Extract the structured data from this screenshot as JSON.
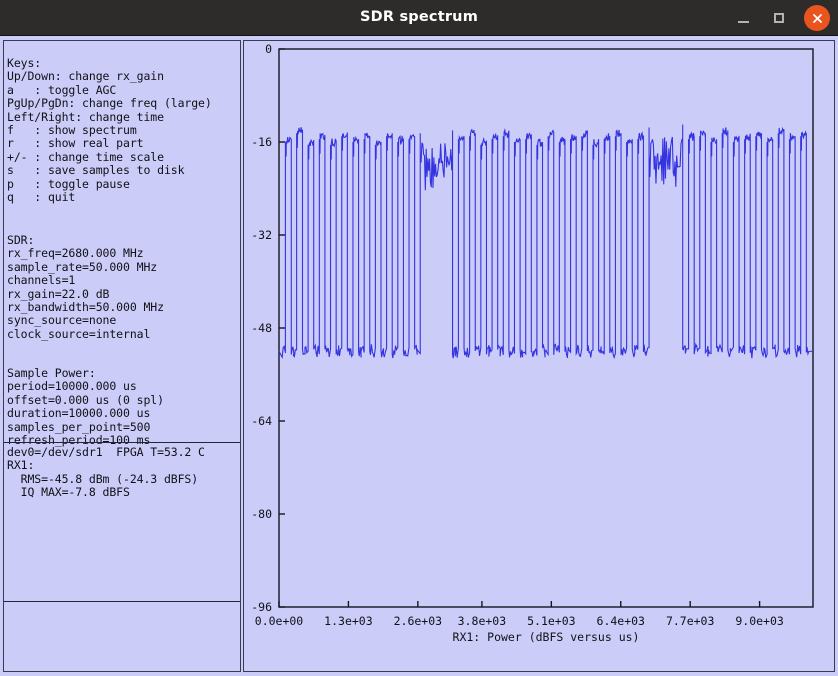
{
  "window": {
    "title": "SDR spectrum",
    "controls": {
      "minimize": "minimize-button",
      "maximize": "maximize-button",
      "close": "close-button"
    },
    "bg_color": "#ccccf8",
    "titlebar_color": "#2e2c2b",
    "close_color": "#e9541f"
  },
  "info_panel": {
    "keys_section": {
      "heading": "Keys:",
      "lines": [
        "Up/Down: change rx_gain",
        "a   : toggle AGC",
        "PgUp/PgDn: change freq (large)",
        "Left/Right: change time",
        "f   : show spectrum",
        "r   : show real part",
        "+/- : change time scale",
        "s   : save samples to disk",
        "p   : toggle pause",
        "q   : quit"
      ]
    },
    "sdr_section": {
      "heading": "SDR:",
      "lines": [
        "rx_freq=2680.000 MHz",
        "sample_rate=50.000 MHz",
        "channels=1",
        "rx_gain=22.0 dB",
        "rx_bandwidth=50.000 MHz",
        "sync_source=none",
        "clock_source=internal"
      ]
    },
    "sample_power_section": {
      "heading": "Sample Power:",
      "lines": [
        "period=10000.000 us",
        "offset=0.000 us (0 spl)",
        "duration=10000.000 us",
        "samples_per_point=500",
        "refresh_period=100 ms"
      ]
    },
    "status_section": {
      "lines": [
        "dev0=/dev/sdr1  FPGA T=53.2 C",
        "RX1:",
        "  RMS=-45.8 dBm (-24.3 dBFS)",
        "  IQ MAX=-7.8 dBFS"
      ]
    }
  },
  "chart_data": {
    "type": "line",
    "title": "",
    "xlabel": "RX1: Power (dBFS versus us)",
    "ylabel": "",
    "line_color": "#3333e0",
    "plot_bg": "#ccccf8",
    "grid": false,
    "xlim": [
      0,
      10000
    ],
    "ylim": [
      -96,
      0
    ],
    "xticks": [
      0,
      1300,
      2600,
      3800,
      5100,
      6400,
      7700,
      9000
    ],
    "xticklabels": [
      "0.0e+00",
      "1.3e+03",
      "2.6e+03",
      "3.8e+03",
      "5.1e+03",
      "6.4e+03",
      "7.7e+03",
      "9.0e+03"
    ],
    "yticks": [
      0,
      -16,
      -32,
      -48,
      -64,
      -80,
      -96
    ],
    "yticklabels": [
      "0",
      "-16",
      "-32",
      "-48",
      "-64",
      "-80",
      "-96"
    ],
    "baseline_dbfs": -52,
    "pulse_peak_dbfs": -16,
    "description": "Pulsed power vs time: ~34 rectangular pulses rising from a -52 dBFS noise floor to about -16 dBFS peaks, interrupted by two wider noisy high-level bursts near 2.7e+03 us and 7.2e+03 us.",
    "pulses": [
      {
        "x0": 120,
        "x1": 230,
        "top": -17.5
      },
      {
        "x0": 330,
        "x1": 440,
        "top": -16.0
      },
      {
        "x0": 545,
        "x1": 650,
        "top": -18.0
      },
      {
        "x0": 755,
        "x1": 860,
        "top": -17.0
      },
      {
        "x0": 965,
        "x1": 1070,
        "top": -18.0
      },
      {
        "x0": 1175,
        "x1": 1280,
        "top": -16.5
      },
      {
        "x0": 1385,
        "x1": 1490,
        "top": -17.5
      },
      {
        "x0": 1595,
        "x1": 1700,
        "top": -17.0
      },
      {
        "x0": 1805,
        "x1": 1910,
        "top": -18.0
      },
      {
        "x0": 2015,
        "x1": 2120,
        "top": -16.5
      },
      {
        "x0": 2225,
        "x1": 2330,
        "top": -17.5
      },
      {
        "x0": 2435,
        "x1": 2540,
        "top": -17.0
      },
      {
        "x0": 2645,
        "x1": 3250,
        "top": -16.0,
        "noisy": true
      },
      {
        "x0": 3360,
        "x1": 3465,
        "top": -17.0
      },
      {
        "x0": 3570,
        "x1": 3675,
        "top": -16.5
      },
      {
        "x0": 3780,
        "x1": 3885,
        "top": -18.0
      },
      {
        "x0": 3990,
        "x1": 4095,
        "top": -17.0
      },
      {
        "x0": 4200,
        "x1": 4305,
        "top": -16.5
      },
      {
        "x0": 4410,
        "x1": 4515,
        "top": -17.5
      },
      {
        "x0": 4620,
        "x1": 4725,
        "top": -17.0
      },
      {
        "x0": 4830,
        "x1": 4935,
        "top": -18.0
      },
      {
        "x0": 5040,
        "x1": 5145,
        "top": -16.5
      },
      {
        "x0": 5250,
        "x1": 5355,
        "top": -17.5
      },
      {
        "x0": 5460,
        "x1": 5565,
        "top": -17.0
      },
      {
        "x0": 5670,
        "x1": 5775,
        "top": -16.5
      },
      {
        "x0": 5880,
        "x1": 5985,
        "top": -18.0
      },
      {
        "x0": 6090,
        "x1": 6195,
        "top": -17.0
      },
      {
        "x0": 6300,
        "x1": 6405,
        "top": -16.5
      },
      {
        "x0": 6510,
        "x1": 6615,
        "top": -17.5
      },
      {
        "x0": 6720,
        "x1": 6825,
        "top": -17.0
      },
      {
        "x0": 6930,
        "x1": 7560,
        "top": -15.0,
        "noisy": true
      },
      {
        "x0": 7670,
        "x1": 7775,
        "top": -17.0
      },
      {
        "x0": 7880,
        "x1": 7985,
        "top": -16.5
      },
      {
        "x0": 8090,
        "x1": 8195,
        "top": -17.5
      },
      {
        "x0": 8300,
        "x1": 8405,
        "top": -16.0
      },
      {
        "x0": 8510,
        "x1": 8615,
        "top": -17.5
      },
      {
        "x0": 8720,
        "x1": 8825,
        "top": -17.0
      },
      {
        "x0": 8930,
        "x1": 9035,
        "top": -16.5
      },
      {
        "x0": 9140,
        "x1": 9245,
        "top": -17.5
      },
      {
        "x0": 9350,
        "x1": 9455,
        "top": -16.0
      },
      {
        "x0": 9560,
        "x1": 9665,
        "top": -17.0
      },
      {
        "x0": 9770,
        "x1": 9875,
        "top": -16.5
      }
    ]
  }
}
